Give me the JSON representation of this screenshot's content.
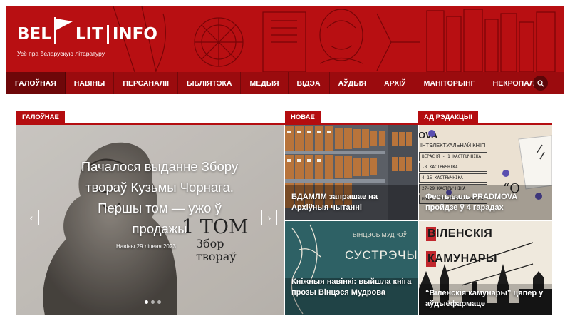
{
  "brand": {
    "logo_left": "BEL",
    "logo_mid": "LIT",
    "logo_right": "INFO",
    "tagline": "Усё пра беларускую літаратуру"
  },
  "nav": {
    "items": [
      "ГАЛОЎНАЯ",
      "НАВІНЫ",
      "ПЕРСАНАЛІІ",
      "БІБЛІЯТЭКА",
      "МЕДЫЯ",
      "ВІДЭА",
      "АЎДЫЯ",
      "АРХІЎ",
      "МАНІТОРЫНГ",
      "НЕКРОПАЛЬ"
    ],
    "search_icon": "search-icon"
  },
  "sections": {
    "main_label": "ГАЛОЎНАЕ",
    "new_label": "НОВАЕ",
    "editors_label": "АД РЭДАКЦЫІ"
  },
  "featured": {
    "title": "Пачалося выданне Збору твораў Кузьмы Чорнага. Першы том — ужо ў продажы",
    "meta": "Навіны 29 ліпеня 2023",
    "cover_line1": "1 ТОМ",
    "cover_line2": "Збор",
    "cover_line3": "твораў",
    "slides": 3,
    "active_slide": 1
  },
  "tiles": {
    "archive": "БДАМЛМ запрашае на Архіўныя чытанні",
    "pradmova": "Фестываль PRADMOVA пройдзе ў 4 гарадах",
    "pradmova_poster": {
      "header1": "OVA",
      "header2": "ІНТЭЛЕКТУАЛЬНАЙ КНІГІ",
      "rows": [
        "ВЕРАСНЯ - 1 КАСТРЫЧНІКА",
        "-8 КАСТРЫЧНІКА",
        "4-15 КАСТРЫЧНІКА",
        "27-29 КАСТРЫЧНІКА",
        "MOVA — 21-22 КАСТРЫЧНІКА"
      ]
    },
    "mudrou": "Кніжныя навінкі: выйшла кніга прозы Вінцэся Мудрова",
    "mudrou_poster_top": "ВІНЦЭСЬ МУДРОЎ",
    "mudrou_poster_title": "СУСТРЭЧЫ",
    "vilna": "“Віленскія камунары” цяпер у аўдыёфармаце",
    "vilna_poster_line1": "ВІЛЕНСКІЯ",
    "vilna_poster_line2": "КАМУНАРЫ"
  },
  "colors": {
    "brand_red": "#b40d10",
    "nav_red": "#9b0b0e",
    "active_nav": "#6e0709"
  }
}
